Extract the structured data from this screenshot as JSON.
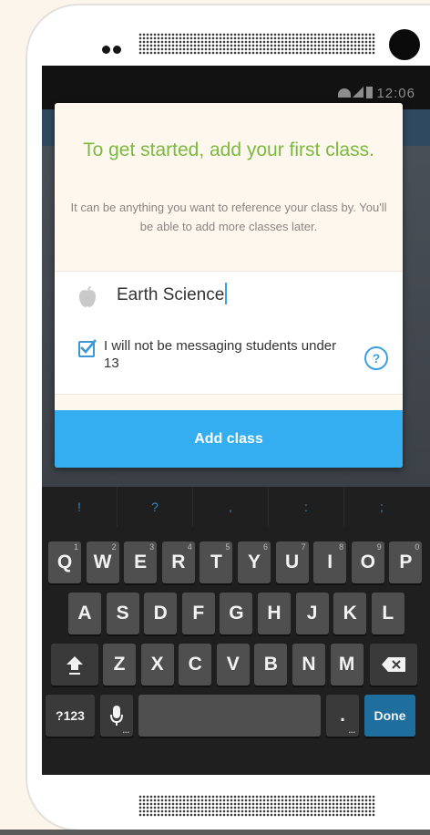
{
  "status_bar": {
    "time": "12:06"
  },
  "dialog": {
    "title": "To get started, add your first class.",
    "subtitle": "It can be anything you want to reference your class by. You'll be able to add more classes later.",
    "class_name_value": "Earth Science",
    "checkbox_label": "I will not be messaging students under 13",
    "checkbox_checked": true,
    "help_label": "?",
    "add_button_label": "Add class"
  },
  "keyboard": {
    "symbols": [
      "!",
      "?",
      ",",
      ":",
      ";"
    ],
    "row1": [
      {
        "k": "Q",
        "h": "1"
      },
      {
        "k": "W",
        "h": "2"
      },
      {
        "k": "E",
        "h": "3"
      },
      {
        "k": "R",
        "h": "4"
      },
      {
        "k": "T",
        "h": "5"
      },
      {
        "k": "Y",
        "h": "6"
      },
      {
        "k": "U",
        "h": "7"
      },
      {
        "k": "I",
        "h": "8"
      },
      {
        "k": "O",
        "h": "9"
      },
      {
        "k": "P",
        "h": "0"
      }
    ],
    "row2": [
      "A",
      "S",
      "D",
      "F",
      "G",
      "H",
      "J",
      "K",
      "L"
    ],
    "row3": [
      "Z",
      "X",
      "C",
      "V",
      "B",
      "N",
      "M"
    ],
    "mode_label": "?123",
    "period_label": ".",
    "ellipsis": "...",
    "done_label": "Done"
  },
  "colors": {
    "accent_green": "#7bb940",
    "accent_blue": "#34aef0",
    "done_blue": "#1e6f9d"
  }
}
